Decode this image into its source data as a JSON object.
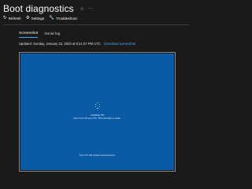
{
  "header": {
    "title": "Boot diagnostics",
    "icons": [
      "pin-icon",
      "more-icon"
    ]
  },
  "toolbar": {
    "refresh_label": "Refresh",
    "settings_label": "Settings",
    "troubleshoot_label": "Troubleshoot"
  },
  "tabs": [
    {
      "label": "Screenshot",
      "active": true
    },
    {
      "label": "Serial log",
      "active": false
    }
  ],
  "status": {
    "updated_text": "Updated: Sunday, January 22, 2023 at 8:21:07 PM UTC",
    "download_link": "Download screenshot"
  },
  "screen": {
    "line1": "Updating 0%",
    "line2": "Don't turn off your PC. This will take a while.",
    "line3": "Your PC will restart several times.",
    "background_color": "#0b5aa6"
  }
}
